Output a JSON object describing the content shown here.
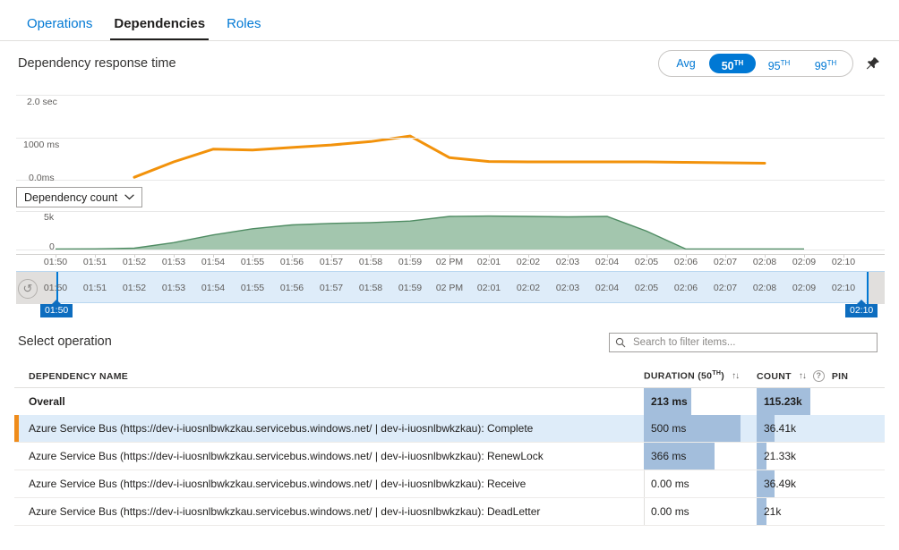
{
  "tabs": [
    {
      "label": "Operations",
      "active": false
    },
    {
      "label": "Dependencies",
      "active": true
    },
    {
      "label": "Roles",
      "active": false
    }
  ],
  "chart_header": {
    "title": "Dependency response time",
    "percentiles": [
      {
        "label": "Avg",
        "sup": "",
        "selected": false
      },
      {
        "label": "50",
        "sup": "TH",
        "selected": true
      },
      {
        "label": "95",
        "sup": "TH",
        "selected": false
      },
      {
        "label": "99",
        "sup": "TH",
        "selected": false
      }
    ],
    "pin_icon": "pin-icon"
  },
  "metric_dropdown": {
    "value": "Dependency count",
    "chevron": "chevron-down-icon"
  },
  "brush": {
    "reset_icon": "reset-time-range-icon",
    "left_marker": "01:50",
    "right_marker": "02:10"
  },
  "select_operation": {
    "label": "Select operation",
    "search_placeholder": "Search to filter items...",
    "search_value": "",
    "search_icon": "search-icon"
  },
  "table": {
    "headers": {
      "name": "DEPENDENCY NAME",
      "duration": "DURATION (50",
      "duration_sup": "TH",
      "duration_suffix": ")",
      "count": "COUNT",
      "pin": "PIN",
      "sort_icon": "↑↓",
      "help_icon": "?"
    },
    "rows": [
      {
        "name": "Overall",
        "duration": "213 ms",
        "count": "115.23k",
        "duration_pct": 42,
        "count_pct": 42,
        "overall": true,
        "selected": false
      },
      {
        "name": "Azure Service Bus (https://dev-i-iuosnlbwkzkau.servicebus.windows.net/ | dev-i-iuosnlbwkzkau): Complete",
        "duration": "500 ms",
        "count": "36.41k",
        "duration_pct": 86,
        "count_pct": 14,
        "overall": false,
        "selected": true
      },
      {
        "name": "Azure Service Bus (https://dev-i-iuosnlbwkzkau.servicebus.windows.net/ | dev-i-iuosnlbwkzkau): RenewLock",
        "duration": "366 ms",
        "count": "21.33k",
        "duration_pct": 63,
        "count_pct": 8,
        "overall": false,
        "selected": false
      },
      {
        "name": "Azure Service Bus (https://dev-i-iuosnlbwkzkau.servicebus.windows.net/ | dev-i-iuosnlbwkzkau): Receive",
        "duration": "0.00 ms",
        "count": "36.49k",
        "duration_pct": 0,
        "count_pct": 14,
        "overall": false,
        "selected": false
      },
      {
        "name": "Azure Service Bus (https://dev-i-iuosnlbwkzkau.servicebus.windows.net/ | dev-i-iuosnlbwkzkau): DeadLetter",
        "duration": "0.00 ms",
        "count": "21k",
        "duration_pct": 0,
        "count_pct": 8,
        "overall": false,
        "selected": false
      }
    ]
  },
  "chart_data": [
    {
      "type": "line",
      "title": "Dependency response time",
      "series": [
        {
          "name": "Dependency response time (50th percentile)",
          "color": "#f2920b",
          "values": [
            null,
            null,
            60,
            420,
            720,
            700,
            760,
            820,
            900,
            1030,
            520,
            430,
            420,
            420,
            420,
            420,
            410,
            400,
            390,
            null,
            null
          ]
        }
      ],
      "x": [
        "01:50",
        "01:51",
        "01:52",
        "01:53",
        "01:54",
        "01:55",
        "01:56",
        "01:57",
        "01:58",
        "01:59",
        "02 PM",
        "02:01",
        "02:02",
        "02:03",
        "02:04",
        "02:05",
        "02:06",
        "02:07",
        "02:08",
        "02:09",
        "02:10"
      ],
      "ylabel": "",
      "ytick_labels": [
        "2.0 sec",
        "1000 ms",
        "0.0ms"
      ],
      "ylim": [
        0,
        2000
      ],
      "grid": true,
      "legend": "none"
    },
    {
      "type": "area",
      "title": "Dependency count",
      "series": [
        {
          "name": "Dependency count",
          "color": "#7aab8a",
          "values": [
            60,
            80,
            180,
            900,
            1900,
            2700,
            3200,
            3400,
            3500,
            3700,
            4300,
            4350,
            4300,
            4250,
            4300,
            2400,
            60,
            60,
            60,
            60,
            null
          ]
        }
      ],
      "x": [
        "01:50",
        "01:51",
        "01:52",
        "01:53",
        "01:54",
        "01:55",
        "01:56",
        "01:57",
        "01:58",
        "01:59",
        "02 PM",
        "02:01",
        "02:02",
        "02:03",
        "02:04",
        "02:05",
        "02:06",
        "02:07",
        "02:08",
        "02:09",
        "02:10"
      ],
      "ytick_labels": [
        "5k",
        "0"
      ],
      "ylim": [
        0,
        5000
      ],
      "grid": true,
      "legend": "none"
    }
  ],
  "time_axis": {
    "ticks": [
      "01:50",
      "01:51",
      "01:52",
      "01:53",
      "01:54",
      "01:55",
      "01:56",
      "01:57",
      "01:58",
      "01:59",
      "02 PM",
      "02:01",
      "02:02",
      "02:03",
      "02:04",
      "02:05",
      "02:06",
      "02:07",
      "02:08",
      "02:09",
      "02:10"
    ]
  }
}
